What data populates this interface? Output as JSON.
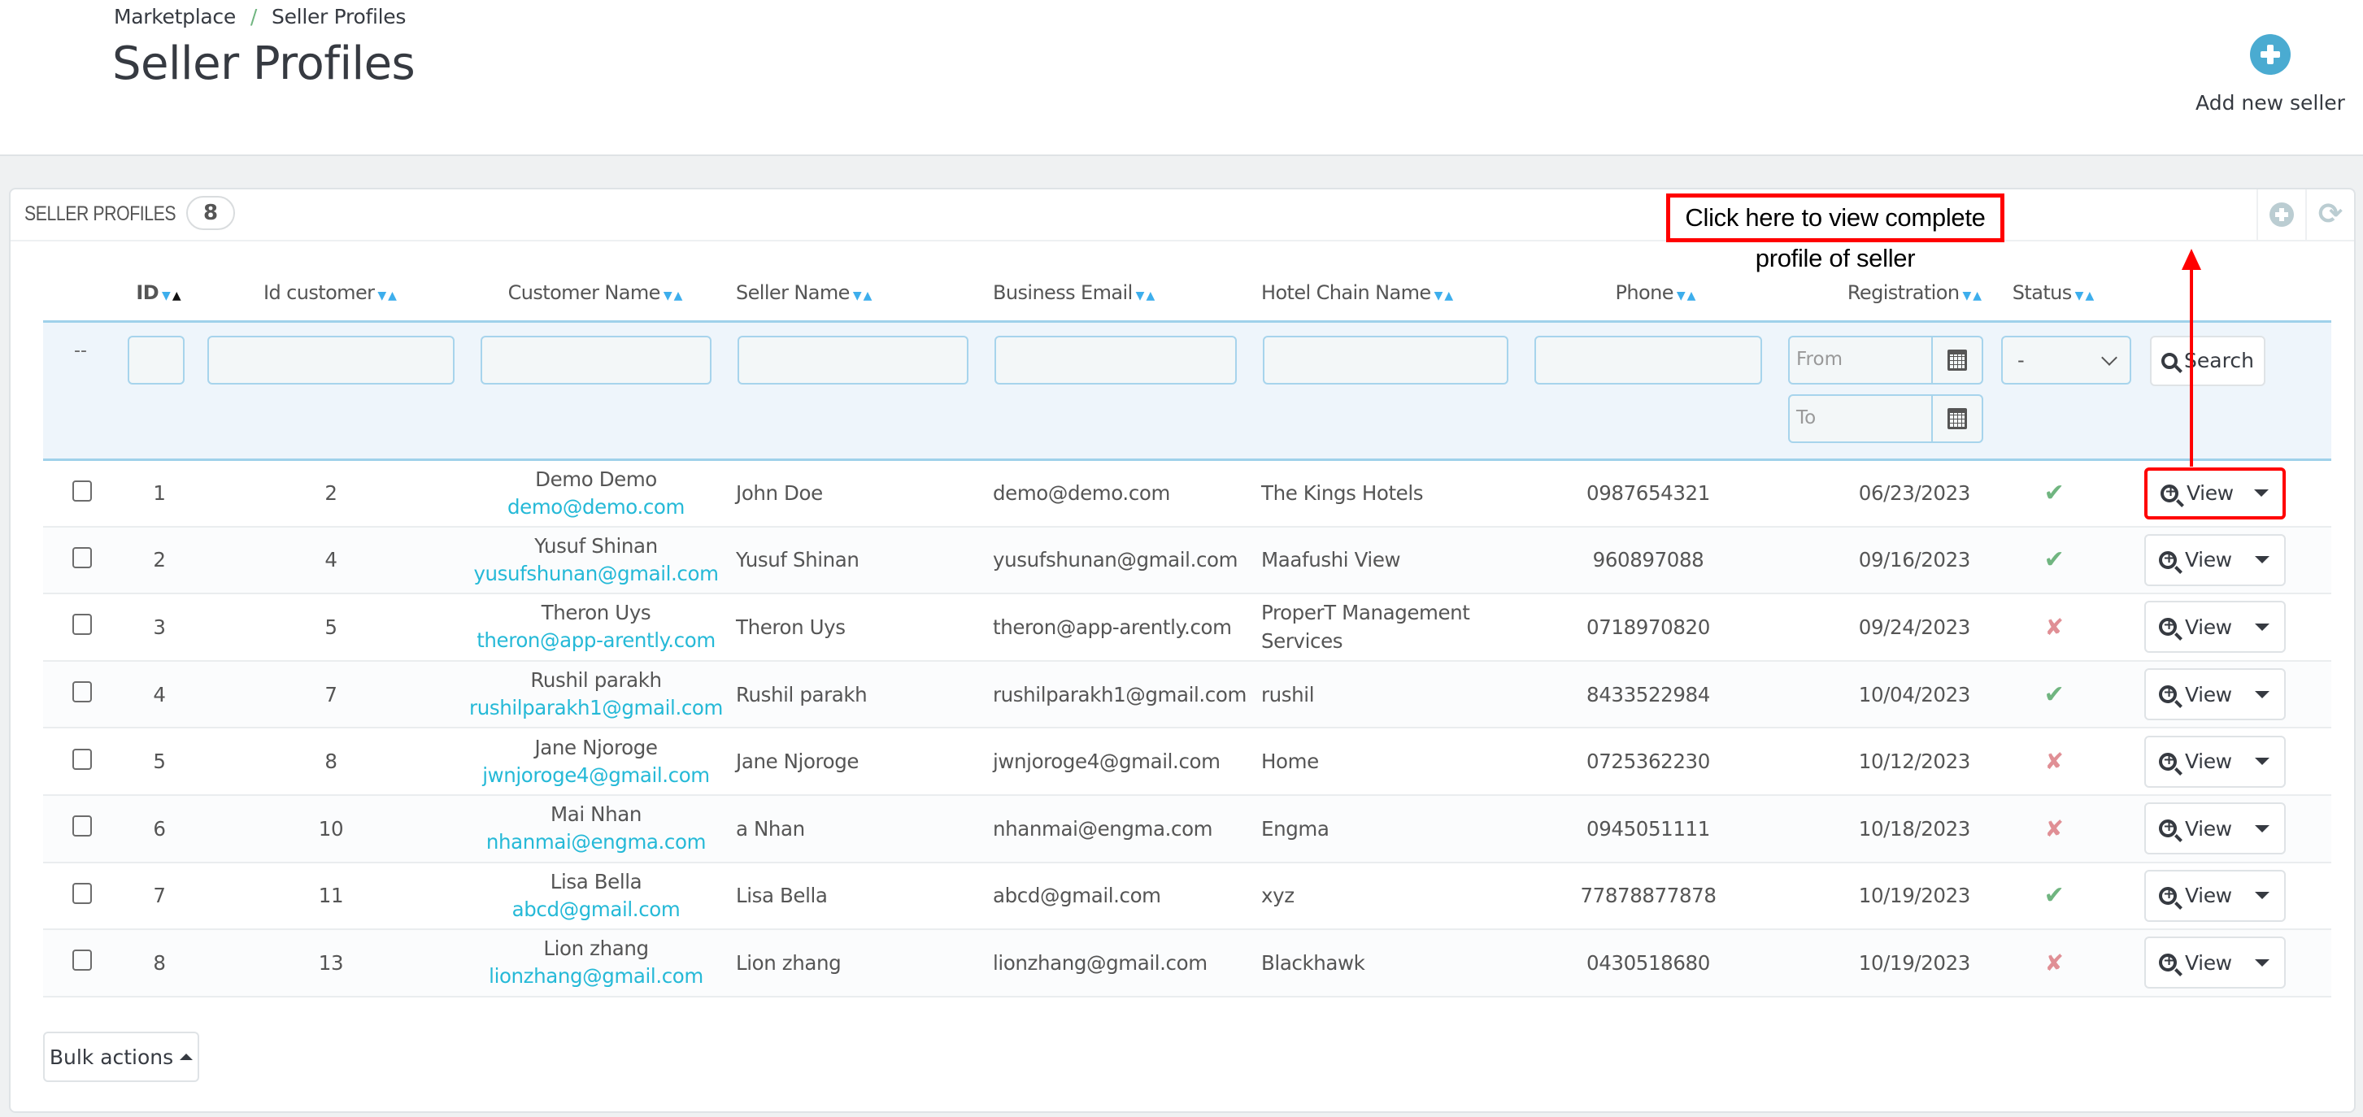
{
  "breadcrumb": {
    "parent": "Marketplace",
    "separator": "/",
    "current": "Seller Profiles"
  },
  "page_title": "Seller Profiles",
  "toolbar": {
    "add_label": "Add new seller"
  },
  "panel": {
    "title": "SELLER PROFILES",
    "count": "8",
    "tools": [
      "add-icon",
      "refresh-icon"
    ]
  },
  "columns": {
    "id": "ID",
    "id_customer": "Id customer",
    "customer_name": "Customer Name",
    "seller_name": "Seller Name",
    "business_email": "Business Email",
    "hotel_chain": "Hotel Chain Name",
    "phone": "Phone",
    "registration": "Registration",
    "status": "Status"
  },
  "sort_glyphs": {
    "desc": "▼",
    "asc": "▲"
  },
  "filters": {
    "bulk_placeholder": "--",
    "date_from_placeholder": "From",
    "date_to_placeholder": "To",
    "status_selected": "-",
    "search_label": "Search"
  },
  "rows": [
    {
      "id": "1",
      "id_customer": "2",
      "customer_name": "Demo Demo",
      "customer_email": "demo@demo.com",
      "seller_name": "John Doe",
      "business_email": "demo@demo.com",
      "hotel_chain": "The Kings Hotels",
      "phone": "0987654321",
      "registration": "06/23/2023",
      "status": "active",
      "status_glyph": "✔",
      "view_label": "View"
    },
    {
      "id": "2",
      "id_customer": "4",
      "customer_name": "Yusuf Shinan",
      "customer_email": "yusufshunan@gmail.com",
      "seller_name": "Yusuf Shinan",
      "business_email": "yusufshunan@gmail.com",
      "hotel_chain": "Maafushi View",
      "phone": "960897088",
      "registration": "09/16/2023",
      "status": "active",
      "status_glyph": "✔",
      "view_label": "View"
    },
    {
      "id": "3",
      "id_customer": "5",
      "customer_name": "Theron Uys",
      "customer_email": "theron@app-arently.com",
      "seller_name": "Theron Uys",
      "business_email": "theron@app-arently.com",
      "hotel_chain": "ProperT Management Services",
      "phone": "0718970820",
      "registration": "09/24/2023",
      "status": "inactive",
      "status_glyph": "✘",
      "view_label": "View"
    },
    {
      "id": "4",
      "id_customer": "7",
      "customer_name": "Rushil parakh",
      "customer_email": "rushilparakh1@gmail.com",
      "seller_name": "Rushil parakh",
      "business_email": "rushilparakh1@gmail.com",
      "hotel_chain": "rushil",
      "phone": "8433522984",
      "registration": "10/04/2023",
      "status": "active",
      "status_glyph": "✔",
      "view_label": "View"
    },
    {
      "id": "5",
      "id_customer": "8",
      "customer_name": "Jane Njoroge",
      "customer_email": "jwnjoroge4@gmail.com",
      "seller_name": "Jane Njoroge",
      "business_email": "jwnjoroge4@gmail.com",
      "hotel_chain": "Home",
      "phone": "0725362230",
      "registration": "10/12/2023",
      "status": "inactive",
      "status_glyph": "✘",
      "view_label": "View"
    },
    {
      "id": "6",
      "id_customer": "10",
      "customer_name": "Mai Nhan",
      "customer_email": "nhanmai@engma.com",
      "seller_name": "a Nhan",
      "business_email": "nhanmai@engma.com",
      "hotel_chain": "Engma",
      "phone": "0945051111",
      "registration": "10/18/2023",
      "status": "inactive",
      "status_glyph": "✘",
      "view_label": "View"
    },
    {
      "id": "7",
      "id_customer": "11",
      "customer_name": "Lisa Bella",
      "customer_email": "abcd@gmail.com",
      "seller_name": "Lisa Bella",
      "business_email": "abcd@gmail.com",
      "hotel_chain": "xyz",
      "phone": "77878877878",
      "registration": "10/19/2023",
      "status": "active",
      "status_glyph": "✔",
      "view_label": "View"
    },
    {
      "id": "8",
      "id_customer": "13",
      "customer_name": "Lion zhang",
      "customer_email": "lionzhang@gmail.com",
      "seller_name": "Lion zhang",
      "business_email": "lionzhang@gmail.com",
      "hotel_chain": "Blackhawk",
      "phone": "0430518680",
      "registration": "10/19/2023",
      "status": "inactive",
      "status_glyph": "✘",
      "view_label": "View"
    }
  ],
  "bulk_actions_label": "Bulk actions",
  "annotation": {
    "text": "Click here to view complete profile of seller",
    "color": "#ff0000"
  },
  "colors": {
    "accent": "#25b9d7",
    "active": "#70b580",
    "inactive": "#e08f95",
    "filter_bg": "#eef5fb",
    "filter_border": "#9fd1ea"
  }
}
